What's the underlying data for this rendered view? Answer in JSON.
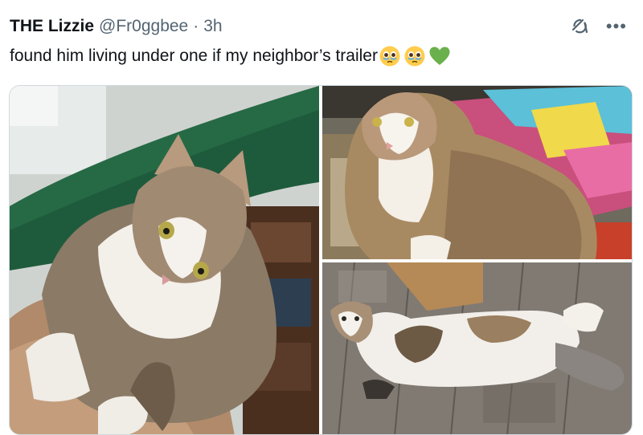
{
  "tweet": {
    "display_name": "THE Lizzie",
    "handle": "@Fr0ggbee",
    "separator": "·",
    "time": "3h",
    "text": "found him living under one if my neighbor’s trailer",
    "emojis": [
      "face-holding-back-tears",
      "face-holding-back-tears",
      "green-heart"
    ]
  },
  "actions": {
    "grok_icon": "grok-icon",
    "more": "•••"
  },
  "media": {
    "photos": [
      {
        "icon": "photo-cat-on-couch"
      },
      {
        "icon": "photo-cat-sitting-by-boxes"
      },
      {
        "icon": "photo-cat-lying-on-floor"
      }
    ]
  }
}
